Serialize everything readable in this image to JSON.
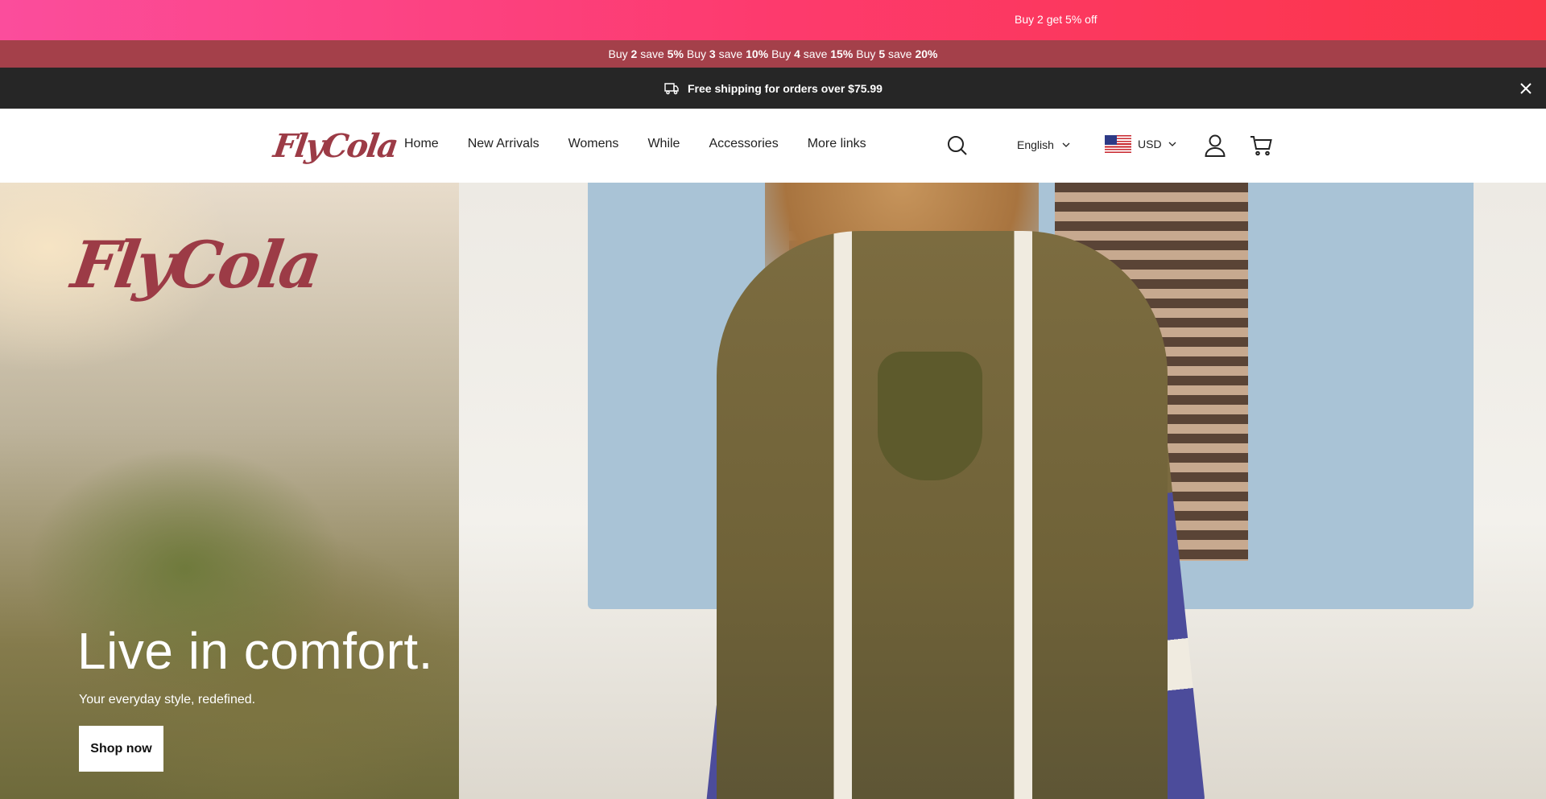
{
  "promo": {
    "text": "Buy 2 get 5% off"
  },
  "tiers": [
    {
      "pre": "Buy",
      "qty": "2",
      "mid": "save",
      "pct": "5%"
    },
    {
      "pre": "Buy",
      "qty": "3",
      "mid": "save",
      "pct": "10%"
    },
    {
      "pre": "Buy",
      "qty": "4",
      "mid": "save",
      "pct": "15%"
    },
    {
      "pre": "Buy",
      "qty": "5",
      "mid": "save",
      "pct": "20%"
    }
  ],
  "shipping": {
    "text": "Free shipping for orders over $75.99",
    "icon": "delivery-truck-icon"
  },
  "header": {
    "logo": "FlyCola",
    "nav": [
      "Home",
      "New Arrivals",
      "Womens",
      "While",
      "Accessories",
      "More links"
    ],
    "language": "English",
    "currency": "USD"
  },
  "hero": {
    "logo": "FlyCola",
    "title": "Live in comfort.",
    "subtitle": "Your everyday style, redefined.",
    "cta": "Shop now"
  },
  "colors": {
    "promo_gradient_start": "#fb4d9c",
    "promo_gradient_end": "#fb3548",
    "tiers_bg": "#a4404a",
    "shipping_bg": "#262626",
    "brand": "#9c3b46"
  }
}
